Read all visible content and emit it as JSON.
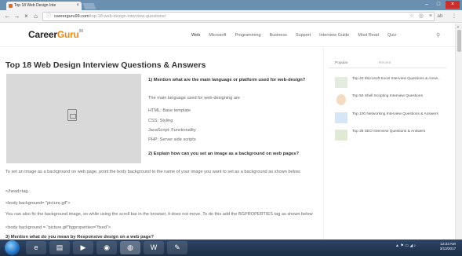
{
  "browser": {
    "tab_title": "Top 18 Web Design Inte",
    "url_host": "careerguru99.com",
    "url_path": "/top-18-web-design-interview-questions/",
    "colors": {
      "titlebar": "#6b8fb0",
      "close": "#c9302c"
    }
  },
  "site": {
    "logo_main": "Career",
    "logo_accent": "Guru",
    "logo_sup": "99",
    "nav": [
      "Web",
      "Microsoft",
      "Programming",
      "Business",
      "Support",
      "Interview Guide",
      "Most Read",
      "Quiz"
    ]
  },
  "article": {
    "title": "Top 18 Web Design Interview Questions & Answers",
    "q1": "1) Mention what are the main language or platform used for web-design?",
    "q1_intro": "The main language used for web-designing are",
    "q1_items": [
      "HTML: Base template",
      "CSS: Styling",
      "JavaScript: Functionality",
      "PHP: Server side scripts"
    ],
    "q2": "2) Explain how can you set an image as a background on web pages?",
    "q2_answer": "To set an image as a background on web page, point the body background to the name of your image you want to set as a background as shown below.",
    "code1": "</head>tag.",
    "code2": "<body background= \"picture.gif\">",
    "q2_more": "You can also fix the background image, so while using the scroll bar in the browser, it does not move.  To do this add the BGPROPERTIES tag as shown below",
    "code3": "<body background = \"picture.gif\"bgproperties=\"fixed\">",
    "q3": "3) Mention what do you mean by Responsive design on a web page?"
  },
  "sidebar": {
    "tabs": [
      "Popular",
      "Recent"
    ],
    "items": [
      {
        "label": "Top 40 Microsoft Excel Interview Questions & Answ...",
        "icon": "excel-icon"
      },
      {
        "label": "Top 50 Shell Scripting Interview Questions",
        "icon": "shell-icon"
      },
      {
        "label": "Top 100 Networking Interview Questions & Answers",
        "icon": "network-icon"
      },
      {
        "label": "Top 35 SEO Interview Questions & Answers",
        "icon": "seo-icon"
      }
    ]
  },
  "taskbar": {
    "time": "12:23 AM",
    "date": "3/13/2017"
  }
}
